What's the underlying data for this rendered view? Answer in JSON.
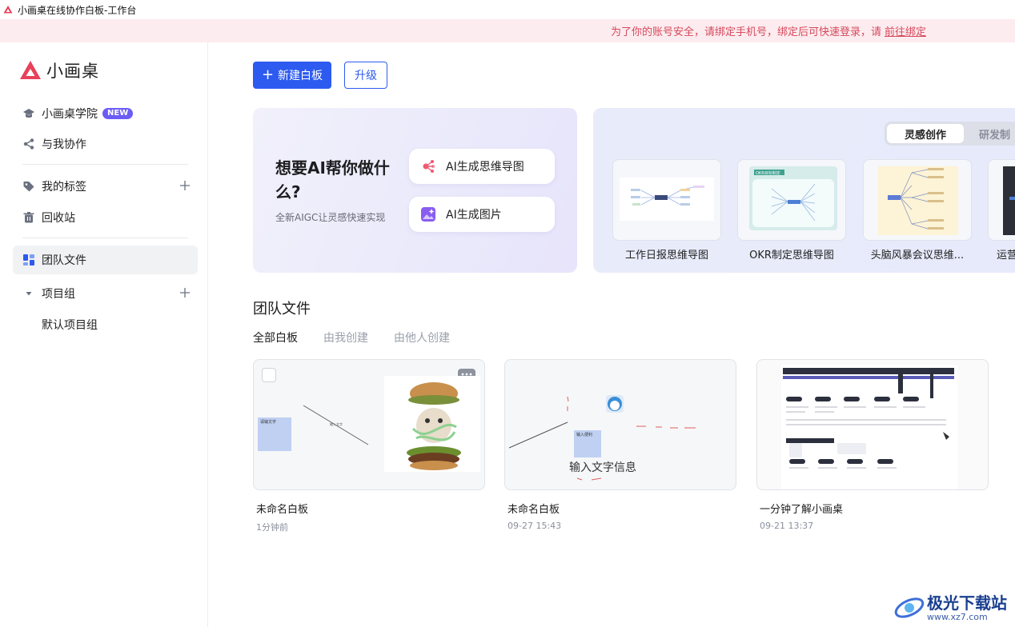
{
  "window": {
    "title": "小画桌在线协作白板-工作台"
  },
  "banner": {
    "text": "为了你的账号安全，请绑定手机号，绑定后可快速登录，请",
    "link": "前往绑定"
  },
  "sidebar": {
    "brand": "小画桌",
    "items": [
      {
        "label": "小画桌学院",
        "badge": "NEW"
      },
      {
        "label": "与我协作"
      },
      {
        "label": "我的标签"
      },
      {
        "label": "回收站"
      },
      {
        "label": "团队文件"
      },
      {
        "label": "项目组"
      },
      {
        "label": "默认项目组"
      }
    ]
  },
  "toolbar": {
    "new_label": "新建白板",
    "upgrade_label": "升级"
  },
  "ai_card": {
    "title": "想要AI帮你做什么?",
    "subtitle": "全新AIGC让灵感快速实现",
    "actions": [
      "AI生成思维导图",
      "AI生成图片"
    ]
  },
  "templates": {
    "tabs": [
      "灵感创作",
      "研发制"
    ],
    "items": [
      "工作日报思维导图",
      "OKR制定思维导图",
      "头脑风暴会议思维...",
      "运营"
    ],
    "thumb_text": "OKR目标制定"
  },
  "files": {
    "section_title": "团队文件",
    "tabs": [
      "全部白板",
      "由我创建",
      "由他人创建"
    ],
    "items": [
      {
        "name": "未命名白板",
        "time": "1分钟前",
        "thumb_note": "请输文字",
        "thumb_line": "输入文字"
      },
      {
        "name": "未命名白板",
        "time": "09-27 15:43",
        "thumb_text": "输入文字信息",
        "thumb_note": "输入便利"
      },
      {
        "name": "一分钟了解小画桌",
        "time": "09-21 13:37"
      }
    ]
  },
  "watermark": {
    "brand": "极光下载站",
    "url": "www.xz7.com"
  },
  "colors": {
    "primary": "#2d5bf0",
    "brand_red": "#e8415a",
    "banner_bg": "#fdecef",
    "badge": "#6b5cf6"
  }
}
